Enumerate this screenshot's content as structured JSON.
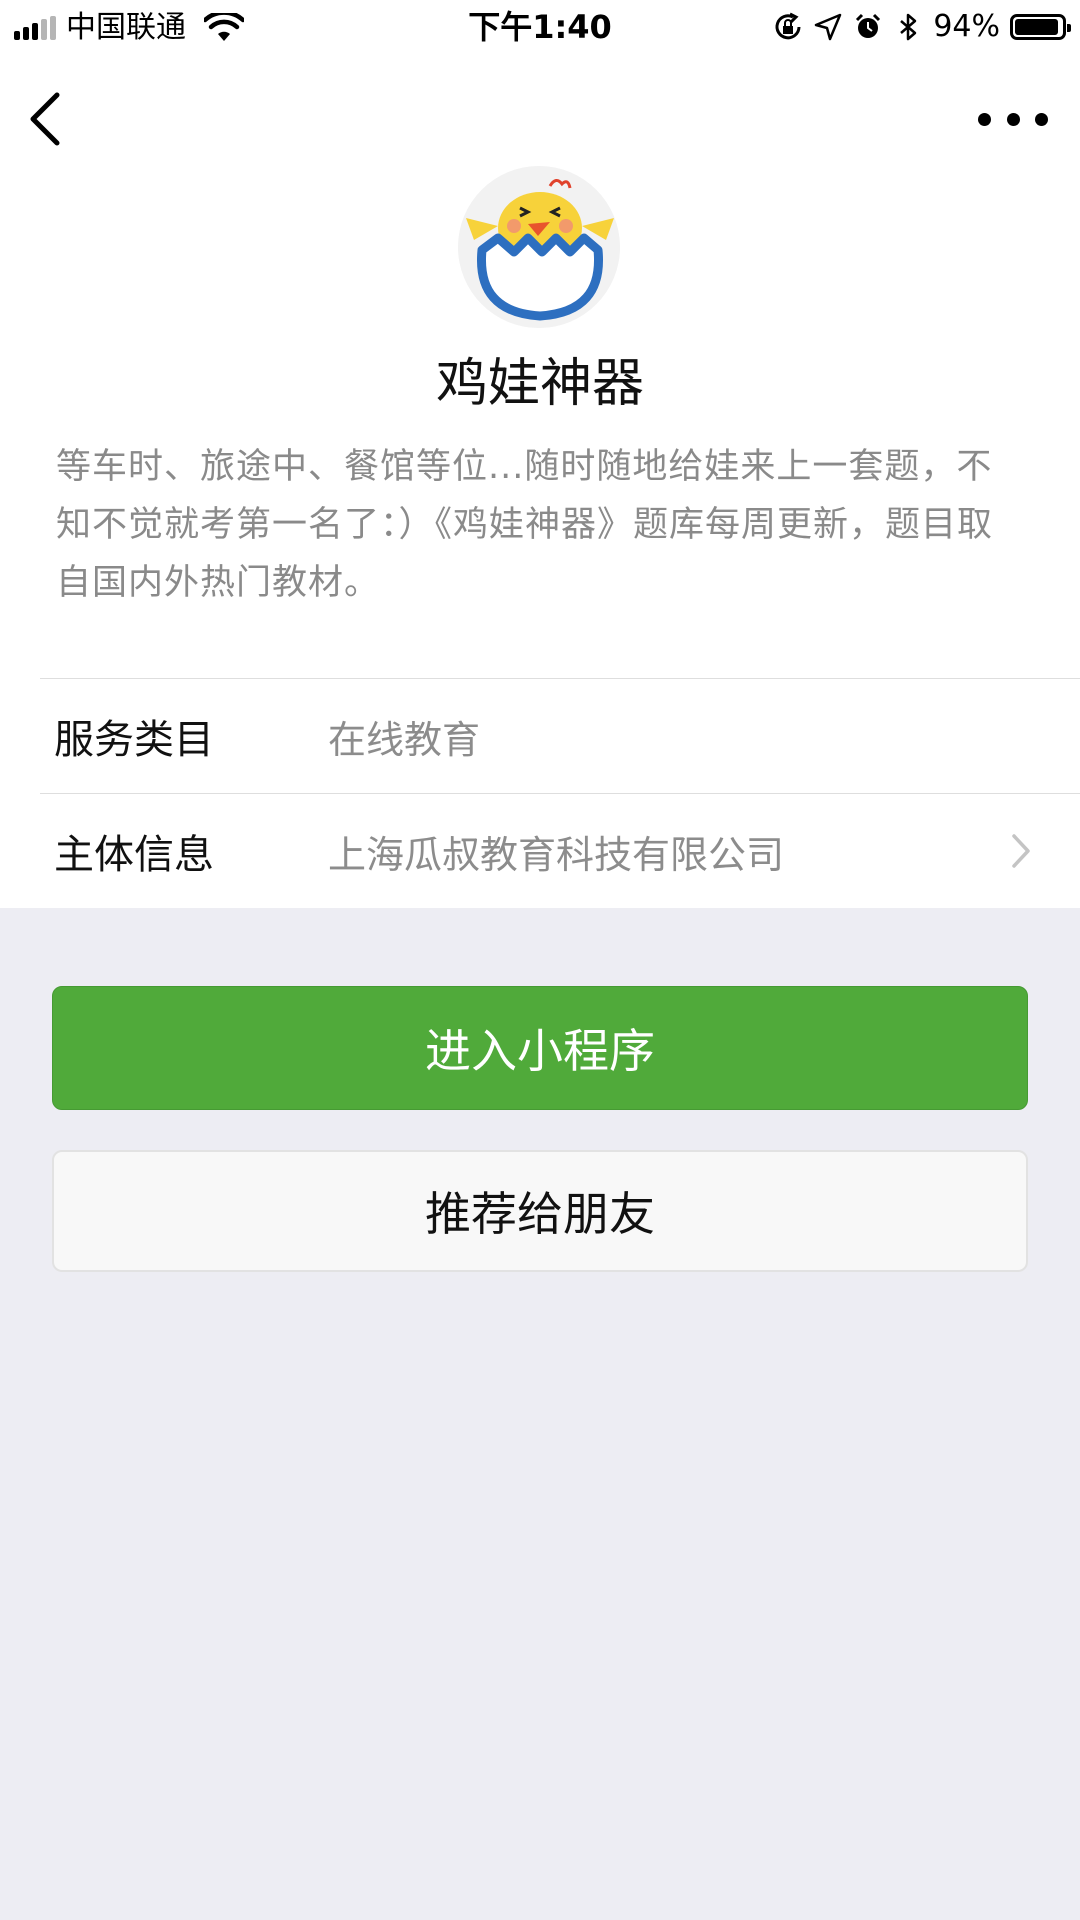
{
  "status_bar": {
    "carrier": "中国联通",
    "time": "下午1:40",
    "battery_percent": "94%",
    "battery_level": 0.94,
    "icons": [
      "signal-icon",
      "wifi-icon",
      "orientation-lock-icon",
      "location-icon",
      "alarm-icon",
      "bluetooth-icon",
      "battery-icon"
    ]
  },
  "nav": {
    "back_icon": "back-chevron-icon",
    "more_icon": "more-dots-icon"
  },
  "app": {
    "avatar_icon": "chick-in-egg-icon",
    "title": "鸡娃神器",
    "description": "等车时、旅途中、餐馆等位...随时随地给娃来上一套题，不知不觉就考第一名了：）《鸡娃神器》题库每周更新，题目取自国内外热门教材。"
  },
  "info": [
    {
      "label": "服务类目",
      "value": "在线教育"
    },
    {
      "label": "主体信息",
      "value": "上海瓜叔教育科技有限公司"
    }
  ],
  "actions": {
    "enter_label": "进入小程序",
    "share_label": "推荐给朋友"
  },
  "colors": {
    "primary_green": "#50aa3a",
    "background": "#ededf3",
    "secondary_text": "#8a8a8a"
  }
}
